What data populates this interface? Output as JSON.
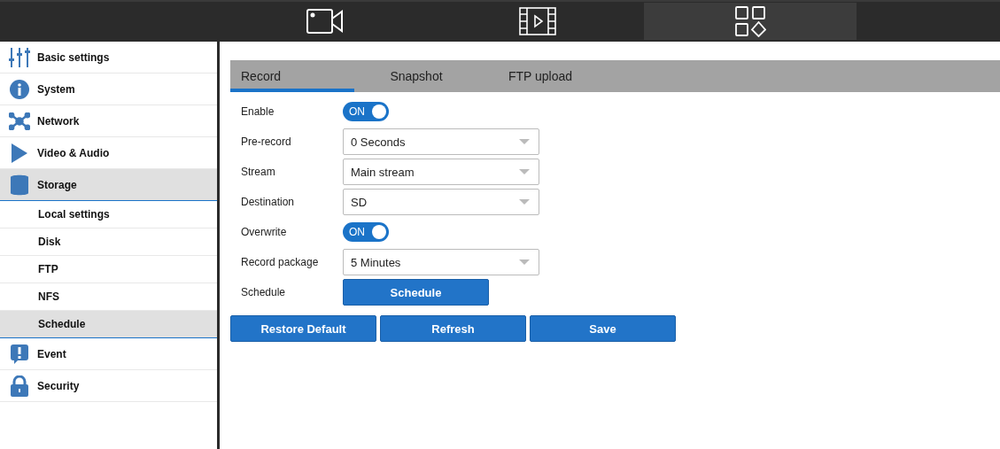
{
  "top_tabs": [
    {
      "selected": false
    },
    {
      "selected": false
    },
    {
      "selected": true
    }
  ],
  "sidebar": {
    "items": [
      {
        "label": "Basic settings",
        "selected": false
      },
      {
        "label": "System",
        "selected": false
      },
      {
        "label": "Network",
        "selected": false
      },
      {
        "label": "Video & Audio",
        "selected": false
      },
      {
        "label": "Storage",
        "selected": true,
        "children": [
          {
            "label": "Local settings",
            "selected": false
          },
          {
            "label": "Disk",
            "selected": false
          },
          {
            "label": "FTP",
            "selected": false
          },
          {
            "label": "NFS",
            "selected": false
          },
          {
            "label": "Schedule",
            "selected": true
          }
        ]
      },
      {
        "label": "Event",
        "selected": false
      },
      {
        "label": "Security",
        "selected": false
      }
    ]
  },
  "tabs": [
    {
      "label": "Record",
      "selected": true
    },
    {
      "label": "Snapshot",
      "selected": false
    },
    {
      "label": "FTP upload",
      "selected": false
    }
  ],
  "form": [
    {
      "label": "Enable",
      "kind": "toggle",
      "on": true,
      "text": "ON"
    },
    {
      "label": "Pre-record",
      "kind": "select",
      "value": "0 Seconds"
    },
    {
      "label": "Stream",
      "kind": "select",
      "value": "Main stream"
    },
    {
      "label": "Destination",
      "kind": "select",
      "value": "SD"
    },
    {
      "label": "Overwrite",
      "kind": "toggle",
      "on": true,
      "text": "ON"
    },
    {
      "label": "Record package",
      "kind": "select",
      "value": "5 Minutes"
    },
    {
      "label": "Schedule",
      "kind": "button",
      "value": "Schedule"
    }
  ],
  "buttons": [
    "Restore Default",
    "Refresh",
    "Save"
  ]
}
